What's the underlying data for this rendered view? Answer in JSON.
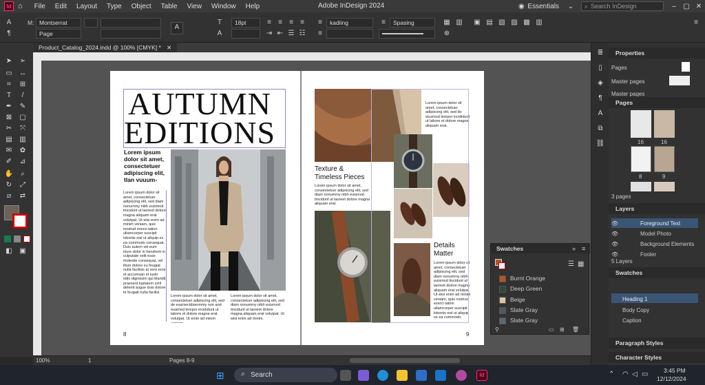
{
  "app": {
    "logo": "Id",
    "title": "Adobe InDesign 2024",
    "menu": [
      "File",
      "Edit",
      "Layout",
      "Type",
      "Object",
      "Table",
      "View",
      "Window",
      "Help"
    ],
    "workspace": "Essentials",
    "search_placeholder": "Search InDesign"
  },
  "control_bar": {
    "font_family": "Montserrat",
    "reference": "Page",
    "font_size": "18pt",
    "kerning": "kadiing",
    "spacing": "Spasing",
    "prefix_m": "M:"
  },
  "document": {
    "tab_label": "Product_Catalog_2024.indd @ 100% [CMYK] *",
    "zoom": "100%",
    "page_field": "1",
    "pages_label": "Pages 8-9"
  },
  "left_page": {
    "headline_1": "AUTUMN",
    "headline_2": "EDITIONS",
    "intro": "Lorem ipsum dolor sit amet, consectetuer adipiscing elit, tlan vuuum-",
    "col1": "Lorem ipsum dolor sit amet, consectetuer adipiscing elit, sed diam nonummy nibh euismod tincidunt ut laoreet dolore magna aliquam erat volutpat. Ut wisi enim ad minim veniam, quis nostrud exerci tation ullamcorper suscipit lobortis nisl ut aliquip ex ea commodo consequat. Duis autem vel eum iriure dolor in hendrerit in vulputate velit esse molestie consequat, vel illum dolore eu feugiat nulla facilisis at vero eros et accumsan et iusto odio dignissim qui blandit praesent luptatum zzril delenit augue duis dolore te feugait nulla facilisi.",
    "col2": "Lorem ipsum dolor sit amet, consectetuer adipiscing elit, sed de esarsectdsenmmy non and euamed tempor incididunt ut labore et dolore magna erat volutpat. Ut enim ad minim veniam.",
    "col3": "Lorem ipsum dolor sit amet, consectetuer adipiscing elit, sed diam nonummy nibh euismod tincidunt ut laoreet dolore magna aliquam erat volutpat. Ut wisi enim ad minim.",
    "page_number": "8"
  },
  "right_page": {
    "top_text": "Lorem ipsum dolor sit amet, consectetuer adipiscing elit, sed do eiusmod tempor incididunt ut labore et dolore magna aliquam erat.",
    "heading_1a": "Texture &",
    "heading_1b": "Timeless Pieces",
    "body_1": "Lorem ipsum dolor sit amet, consectetuer adipiscing elit, sed diam nonummy nibh euismod tincidunt ut laoreet dolore magna aliquam erat.",
    "heading_2a": "Details",
    "heading_2b": "Matter",
    "body_2": "Lorem ipsum dolor sit amet, consectetuer adipiscing elit, sed diam nonummy nibh euismod tincidunt ut laoreet dolore magna aliquam erat volutpat. Ut wisi enim ad minim veniam, quis nostrud exerci tation ullamcorper suscipit lobortis nisl ut aliquip ex ea commodo.",
    "page_number": "9"
  },
  "panels": {
    "properties": {
      "title": "Properties",
      "rows": [
        "Pages",
        "Master pages",
        "Master pages"
      ]
    },
    "pages": {
      "title": "Pages",
      "labels": [
        "16",
        "16",
        "8",
        "9"
      ],
      "footer": "3 pages"
    },
    "layers": {
      "title": "Layers",
      "items": [
        "Foreground Text",
        "Model Photo",
        "Background Elements",
        "Footer"
      ],
      "footer": "5 Layers"
    },
    "swatches_docked": {
      "title": "Swatches",
      "items": [
        "Heading 1",
        "Body Copy",
        "Caption"
      ]
    },
    "paragraph_styles": "Paragraph Styles",
    "character_styles": "Character Styles"
  },
  "swatches_float": {
    "title": "Swatches",
    "items": [
      {
        "name": "Burnt Orange",
        "color": "#b5541f"
      },
      {
        "name": "Deep Green",
        "color": "#2e4a33"
      },
      {
        "name": "Beige",
        "color": "#dcc6a4"
      },
      {
        "name": "Slate Gray",
        "color": "#4b5a66"
      },
      {
        "name": "Slate Gray",
        "color": "#5d6873"
      }
    ]
  },
  "taskbar": {
    "search": "Search",
    "time": "3:45 PM",
    "date": "12/12/2024"
  },
  "colors": {
    "accent": "#ff3366",
    "layer_highlight": "#3b5575",
    "frame_guide": "#9b7fd1"
  }
}
